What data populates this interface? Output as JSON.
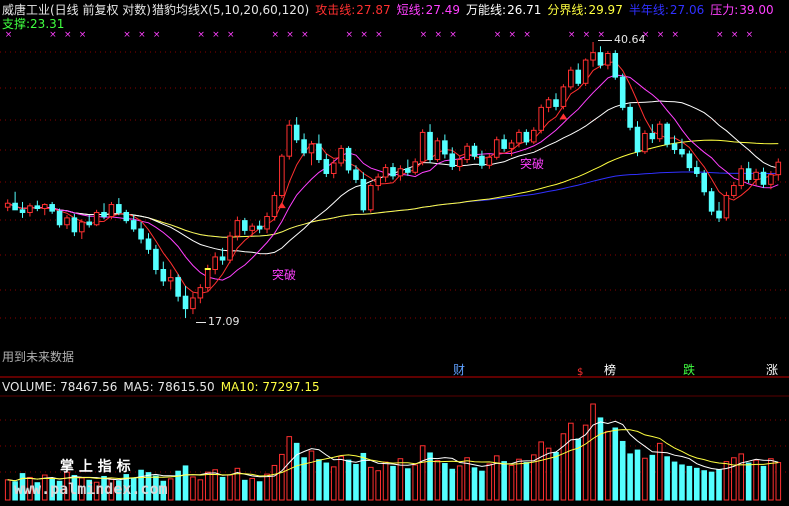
{
  "header": {
    "parts": [
      {
        "text": "威唐工业(日线 前复权 对数)",
        "color": "#e6e6e6"
      },
      {
        "text": "猎豹均线X(5,10,20,60,120)",
        "color": "#e6e6e6"
      },
      {
        "text": "攻击线:",
        "color": "#ff3030"
      },
      {
        "text": "27.87",
        "color": "#ff3030"
      },
      {
        "text": "短线:",
        "color": "#ff40ff"
      },
      {
        "text": "27.49",
        "color": "#ff40ff"
      },
      {
        "text": "万能线:",
        "color": "#ffffff"
      },
      {
        "text": "26.71",
        "color": "#ffffff"
      },
      {
        "text": "分界线:",
        "color": "#ffff40"
      },
      {
        "text": "29.97",
        "color": "#ffff40"
      },
      {
        "text": "半年线:",
        "color": "#3030ff"
      },
      {
        "text": "27.06",
        "color": "#3030ff"
      },
      {
        "text": "压力:",
        "color": "#ff40ff"
      },
      {
        "text": "39.00",
        "color": "#ff40ff"
      }
    ],
    "support_label": "支撑:",
    "support_value": "23.31"
  },
  "annotations": {
    "high_label": "40.64",
    "low_label": "17.09",
    "breakout_1": "突破",
    "breakout_2": "突破",
    "future_data": "用到未来数据",
    "marks": [
      {
        "text": "财",
        "color": "#5fa0ff"
      },
      {
        "text": "$",
        "color": "#ff3030"
      },
      {
        "text": "榜",
        "color": "#ffffff"
      },
      {
        "text": "跌",
        "color": "#40ff40"
      },
      {
        "text": "涨",
        "color": "#ffffff"
      }
    ]
  },
  "volume_header": {
    "parts": [
      {
        "text": "VOLUME: 78467.56",
        "color": "#e6e6e6"
      },
      {
        "text": "MA5: 78615.50",
        "color": "#e6e6e6"
      },
      {
        "text": "MA10: 77297.15",
        "color": "#ffff40"
      }
    ]
  },
  "watermark": {
    "title": "掌 上 指 标",
    "url": "www.palmindex.com"
  },
  "colors": {
    "up": "#ff3030",
    "down": "#54ffff",
    "attack_line": "#ff3030",
    "short_line": "#ff40ff",
    "universal_line": "#ffffff",
    "divide_line": "#ffff40",
    "halfyear_line": "#3030ff",
    "grid": "#8a0000",
    "x_marker": "#ff40ff"
  },
  "chart_data": {
    "type": "candlestick",
    "title": "威唐工业(日线 前复权 对数)",
    "price_range": [
      17.09,
      40.64
    ],
    "candles": [
      [
        24.2,
        24.8,
        23.9,
        24.5
      ],
      [
        24.5,
        25.4,
        24.1,
        24.0
      ],
      [
        24.0,
        24.6,
        23.4,
        23.8
      ],
      [
        23.8,
        24.5,
        23.5,
        24.3
      ],
      [
        24.3,
        24.7,
        23.9,
        24.1
      ],
      [
        24.1,
        24.5,
        23.6,
        24.4
      ],
      [
        24.4,
        24.6,
        23.7,
        23.9
      ],
      [
        23.9,
        24.1,
        22.7,
        22.9
      ],
      [
        22.9,
        23.6,
        22.6,
        23.4
      ],
      [
        23.4,
        23.7,
        22.1,
        22.4
      ],
      [
        22.4,
        23.3,
        21.9,
        23.1
      ],
      [
        23.1,
        23.6,
        22.7,
        22.9
      ],
      [
        22.9,
        24.0,
        22.8,
        23.8
      ],
      [
        23.8,
        24.5,
        23.3,
        23.5
      ],
      [
        23.5,
        24.6,
        23.3,
        24.4
      ],
      [
        24.4,
        24.9,
        23.6,
        23.8
      ],
      [
        23.8,
        24.0,
        23.0,
        23.2
      ],
      [
        23.2,
        23.6,
        22.4,
        22.6
      ],
      [
        22.6,
        23.1,
        21.6,
        21.9
      ],
      [
        21.9,
        22.3,
        20.9,
        21.2
      ],
      [
        21.2,
        21.5,
        19.6,
        19.9
      ],
      [
        19.9,
        20.4,
        18.9,
        19.2
      ],
      [
        19.2,
        19.9,
        18.7,
        19.4
      ],
      [
        19.4,
        19.6,
        18.0,
        18.3
      ],
      [
        18.3,
        18.9,
        17.09,
        17.6
      ],
      [
        17.6,
        18.5,
        17.3,
        18.2
      ],
      [
        18.2,
        19.0,
        17.9,
        18.8
      ],
      [
        18.8,
        20.2,
        18.6,
        19.9
      ],
      [
        19.9,
        21.0,
        19.6,
        20.7
      ],
      [
        20.7,
        21.3,
        20.2,
        20.5
      ],
      [
        20.5,
        22.4,
        20.3,
        22.1
      ],
      [
        22.1,
        23.5,
        21.8,
        23.2
      ],
      [
        23.2,
        23.4,
        22.2,
        22.5
      ],
      [
        22.5,
        23.0,
        22.1,
        22.8
      ],
      [
        22.8,
        23.2,
        22.3,
        22.6
      ],
      [
        22.6,
        23.8,
        22.3,
        23.5
      ],
      [
        23.5,
        25.4,
        23.2,
        25.1
      ],
      [
        25.1,
        28.6,
        24.9,
        28.4
      ],
      [
        28.4,
        31.8,
        28.1,
        31.3
      ],
      [
        31.3,
        32.1,
        29.6,
        29.9
      ],
      [
        29.9,
        30.5,
        28.4,
        28.7
      ],
      [
        28.7,
        29.8,
        27.6,
        29.5
      ],
      [
        29.5,
        30.4,
        27.8,
        28.1
      ],
      [
        28.1,
        28.6,
        26.6,
        26.9
      ],
      [
        26.9,
        28.1,
        26.5,
        27.8
      ],
      [
        27.8,
        29.4,
        27.5,
        29.1
      ],
      [
        29.1,
        29.3,
        26.9,
        27.2
      ],
      [
        27.2,
        27.6,
        26.1,
        26.4
      ],
      [
        26.4,
        27.0,
        23.8,
        24.0
      ],
      [
        24.0,
        26.1,
        23.8,
        25.9
      ],
      [
        25.9,
        26.9,
        25.5,
        26.6
      ],
      [
        26.6,
        27.7,
        26.2,
        27.4
      ],
      [
        27.4,
        27.8,
        26.4,
        26.7
      ],
      [
        26.7,
        27.6,
        26.3,
        27.3
      ],
      [
        27.3,
        28.1,
        26.7,
        27.0
      ],
      [
        27.0,
        28.2,
        26.8,
        27.9
      ],
      [
        27.9,
        30.9,
        27.6,
        30.6
      ],
      [
        30.6,
        31.4,
        27.8,
        28.1
      ],
      [
        28.1,
        30.1,
        27.9,
        29.8
      ],
      [
        29.8,
        30.4,
        28.2,
        28.6
      ],
      [
        28.6,
        29.2,
        27.2,
        27.5
      ],
      [
        27.5,
        28.4,
        27.1,
        28.1
      ],
      [
        28.1,
        29.6,
        27.8,
        29.3
      ],
      [
        29.3,
        29.6,
        28.1,
        28.4
      ],
      [
        28.4,
        28.9,
        27.3,
        27.6
      ],
      [
        27.6,
        28.6,
        27.3,
        28.3
      ],
      [
        28.3,
        30.2,
        28.1,
        29.9
      ],
      [
        29.9,
        30.4,
        28.8,
        29.1
      ],
      [
        29.1,
        29.9,
        28.4,
        29.6
      ],
      [
        29.6,
        30.9,
        29.2,
        30.6
      ],
      [
        30.6,
        30.9,
        29.4,
        29.7
      ],
      [
        29.7,
        31.1,
        29.5,
        30.8
      ],
      [
        30.8,
        33.4,
        30.5,
        33.1
      ],
      [
        33.1,
        34.2,
        32.6,
        33.9
      ],
      [
        33.9,
        34.6,
        32.8,
        33.2
      ],
      [
        33.2,
        35.6,
        32.9,
        35.3
      ],
      [
        35.3,
        37.6,
        35.0,
        37.2
      ],
      [
        37.2,
        38.0,
        35.4,
        35.7
      ],
      [
        35.7,
        38.6,
        35.4,
        38.4
      ],
      [
        38.4,
        40.64,
        37.6,
        39.3
      ],
      [
        39.3,
        40.1,
        37.4,
        37.8
      ],
      [
        37.8,
        39.5,
        37.3,
        39.2
      ],
      [
        39.2,
        39.6,
        36.1,
        36.4
      ],
      [
        36.4,
        36.8,
        32.8,
        33.1
      ],
      [
        33.1,
        33.5,
        30.8,
        31.1
      ],
      [
        31.1,
        31.7,
        28.4,
        28.8
      ],
      [
        28.8,
        30.8,
        28.6,
        30.5
      ],
      [
        30.5,
        31.4,
        29.6,
        30.0
      ],
      [
        30.0,
        31.7,
        29.7,
        31.4
      ],
      [
        31.4,
        31.6,
        29.2,
        29.5
      ],
      [
        29.5,
        30.3,
        28.6,
        29.0
      ],
      [
        29.0,
        30.0,
        28.3,
        28.6
      ],
      [
        28.6,
        28.9,
        27.1,
        27.4
      ],
      [
        27.4,
        28.0,
        26.6,
        26.9
      ],
      [
        26.9,
        27.2,
        25.1,
        25.4
      ],
      [
        25.4,
        25.7,
        23.6,
        23.9
      ],
      [
        23.9,
        24.6,
        23.1,
        23.4
      ],
      [
        23.4,
        25.4,
        23.2,
        25.1
      ],
      [
        25.1,
        26.2,
        24.9,
        25.9
      ],
      [
        25.9,
        27.6,
        25.6,
        27.3
      ],
      [
        27.3,
        27.9,
        26.1,
        26.4
      ],
      [
        26.4,
        27.3,
        25.9,
        27.0
      ],
      [
        27.0,
        27.4,
        25.7,
        26.0
      ],
      [
        26.0,
        27.1,
        25.6,
        26.8
      ],
      [
        26.8,
        28.2,
        26.3,
        27.87
      ]
    ],
    "volume": [
      42,
      38,
      55,
      47,
      36,
      52,
      44,
      39,
      58,
      51,
      46,
      41,
      37,
      49,
      43,
      40,
      53,
      45,
      62,
      57,
      50,
      39,
      44,
      60,
      71,
      48,
      42,
      58,
      63,
      47,
      52,
      66,
      41,
      45,
      38,
      54,
      72,
      95,
      132,
      118,
      88,
      102,
      84,
      77,
      69,
      91,
      83,
      74,
      97,
      68,
      61,
      79,
      70,
      86,
      65,
      73,
      113,
      98,
      82,
      76,
      64,
      71,
      88,
      67,
      60,
      75,
      92,
      80,
      72,
      85,
      78,
      94,
      121,
      108,
      99,
      138,
      160,
      127,
      156,
      200,
      171,
      143,
      150,
      122,
      96,
      104,
      87,
      93,
      118,
      90,
      79,
      73,
      70,
      66,
      61,
      58,
      63,
      80,
      88,
      96,
      77,
      83,
      70,
      86,
      78
    ],
    "volume_ma5": 78615.5,
    "volume_ma10": 77297.15,
    "volume_latest": 78467.56,
    "indicators": {
      "攻击线": 27.87,
      "短线": 27.49,
      "万能线": 26.71,
      "分界线": 29.97,
      "半年线": 27.06,
      "压力": 39.0,
      "支撑": 23.31
    }
  }
}
